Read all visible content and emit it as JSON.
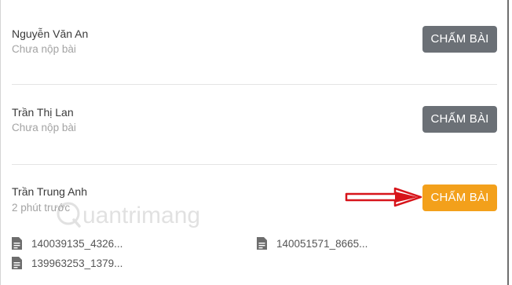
{
  "students": [
    {
      "name": "Nguyễn Văn An",
      "status": "Chưa nộp bài",
      "button_label": "CHẤM BÀI"
    },
    {
      "name": "Trần Thị Lan",
      "status": "Chưa nộp bài",
      "button_label": "CHẤM BÀI"
    },
    {
      "name": "Trần Trung Anh",
      "status": "2 phút trước",
      "button_label": "CHẤM BÀI"
    }
  ],
  "attachments": [
    {
      "name": "140039135_4326...",
      "icon": "document-icon"
    },
    {
      "name": "140051571_8665...",
      "icon": "document-icon"
    },
    {
      "name": "139963253_1379...",
      "icon": "document-icon"
    }
  ],
  "watermark": {
    "text": "uantrimang"
  },
  "colors": {
    "gray_button": "#6b7076",
    "active_button": "#f3a01b",
    "arrow": "#d7141a"
  }
}
